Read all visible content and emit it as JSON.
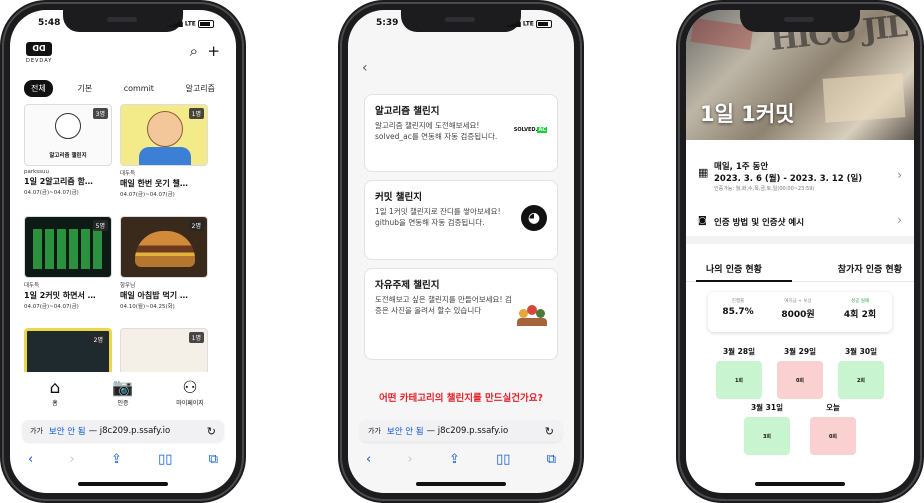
{
  "colors": {
    "accent_blue": "#0a58d6",
    "cta_red": "#e0242a",
    "success_green": "#c8f5cf",
    "fail_red": "#fbd0d0"
  },
  "phone1": {
    "status": {
      "time": "5:48",
      "signal": "LTE"
    },
    "logo": {
      "mark": "ᗡᗡ",
      "name": "DEVDAY"
    },
    "header_icons": [
      "search-icon",
      "plus-icon"
    ],
    "chips": [
      "전체",
      "기본",
      "commit",
      "알고리즘"
    ],
    "cards": [
      {
        "badge": "3명",
        "thumb_text": "알고리즘 챌린지",
        "author": "parkssuu",
        "title": "1일 2알고리즘 함…",
        "date": "04.07(금)~04.07(금)"
      },
      {
        "badge": "1명",
        "thumb_text": "",
        "author": "대두득",
        "title": "매일 한번 웃기 챌…",
        "date": "04.07(금)~04.07(금)"
      },
      {
        "badge": "5명",
        "thumb_text": "",
        "author": "대두득",
        "title": "1일 2커밋 하면서 …",
        "date": "04.07(금)~04.07(금)"
      },
      {
        "badge": "2명",
        "thumb_text": "",
        "author": "항우님",
        "title": "매일 아침밥 먹기 …",
        "date": "04.10(월)~04.25(화)"
      },
      {
        "badge": "2명",
        "thumb_text": "",
        "author": "",
        "title": "",
        "date": ""
      },
      {
        "badge": "1명",
        "thumb_text": "",
        "author": "",
        "title": "",
        "date": ""
      }
    ],
    "tabs": [
      {
        "icon": "home-icon",
        "label": "홈"
      },
      {
        "icon": "camera-icon",
        "label": "인증"
      },
      {
        "icon": "person-icon",
        "label": "마이페이지"
      }
    ],
    "url": {
      "aa": "가가",
      "warning": "보안 안 됨",
      "host": "— j8c209.p.ssafy.io"
    }
  },
  "phone2": {
    "status": {
      "time": "5:39",
      "signal": "LTE"
    },
    "challenges": [
      {
        "title": "알고리즘 챌린지",
        "desc": "알고리즘 챌린지에 도전해보세요! solved_ac를 연동해 자동 검증됩니다.",
        "image": "SOLVED.AC"
      },
      {
        "title": "커밋 챌린지",
        "desc": "1일 1커밋 챌린지로 잔디를 쌓아보세요! github을 연동해 자동 검증됩니다.",
        "image": "github-icon"
      },
      {
        "title": "자유주제 챌린지",
        "desc": "도전해보고 싶은 챌린지를 만들어보세요! 검증은 사진을 올려서 할수 있습니다",
        "image": "people-icon"
      }
    ],
    "prompt": "어떤 카테고리의 챌린지를 만드실건가요?",
    "url": {
      "aa": "가가",
      "warning": "보안 안 됨",
      "host": "— j8c209.p.ssafy.io"
    }
  },
  "phone3": {
    "hero_title": "1일 1커밋",
    "hero_art_text": "HICO JIL",
    "schedule": {
      "title": "매일, 1주 동안",
      "range": "2023. 3. 6 (월) - 2023. 3. 12 (일)",
      "sub": "인증가능: 월,화,수,목,금,토,일(00:00~23:59)"
    },
    "method": "인증 방법 및 인증샷 예시",
    "segments": [
      "나의 인증 현황",
      "참가자 인증 현황"
    ],
    "stats": [
      {
        "label": "진행률",
        "value": "85.7%"
      },
      {
        "label": "예치금 + 보상",
        "value": "8000원"
      },
      {
        "label": "성공 실패",
        "value": "4회 2회"
      }
    ],
    "days": [
      {
        "label": "3월 28일",
        "count": "1회",
        "status": "success"
      },
      {
        "label": "3월 29일",
        "count": "0회",
        "status": "fail"
      },
      {
        "label": "3월 30일",
        "count": "2회",
        "status": "success"
      },
      {
        "label": "3월 31일",
        "count": "3회",
        "status": "success"
      },
      {
        "label": "오늘",
        "count": "0회",
        "status": "fail"
      }
    ]
  }
}
